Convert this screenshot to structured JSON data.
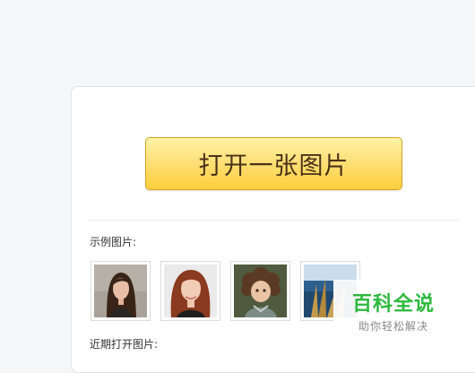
{
  "main": {
    "open_button_label": "打开一张图片",
    "sample_label": "示例图片:",
    "recent_label": "近期打开图片:",
    "sample_images": [
      {
        "icon": "portrait-photo-dark-hair-woman"
      },
      {
        "icon": "portrait-photo-red-hair-woman"
      },
      {
        "icon": "portrait-photo-curly-hair-child"
      },
      {
        "icon": "landscape-photo-sea-grass"
      }
    ]
  },
  "watermark": {
    "title": "百科全说",
    "subtitle": "助你轻松解决"
  },
  "colors": {
    "button_top": "#fff3a6",
    "button_bottom": "#fccf3c",
    "button_text": "#4b3218",
    "watermark_green": "#2db83d"
  }
}
